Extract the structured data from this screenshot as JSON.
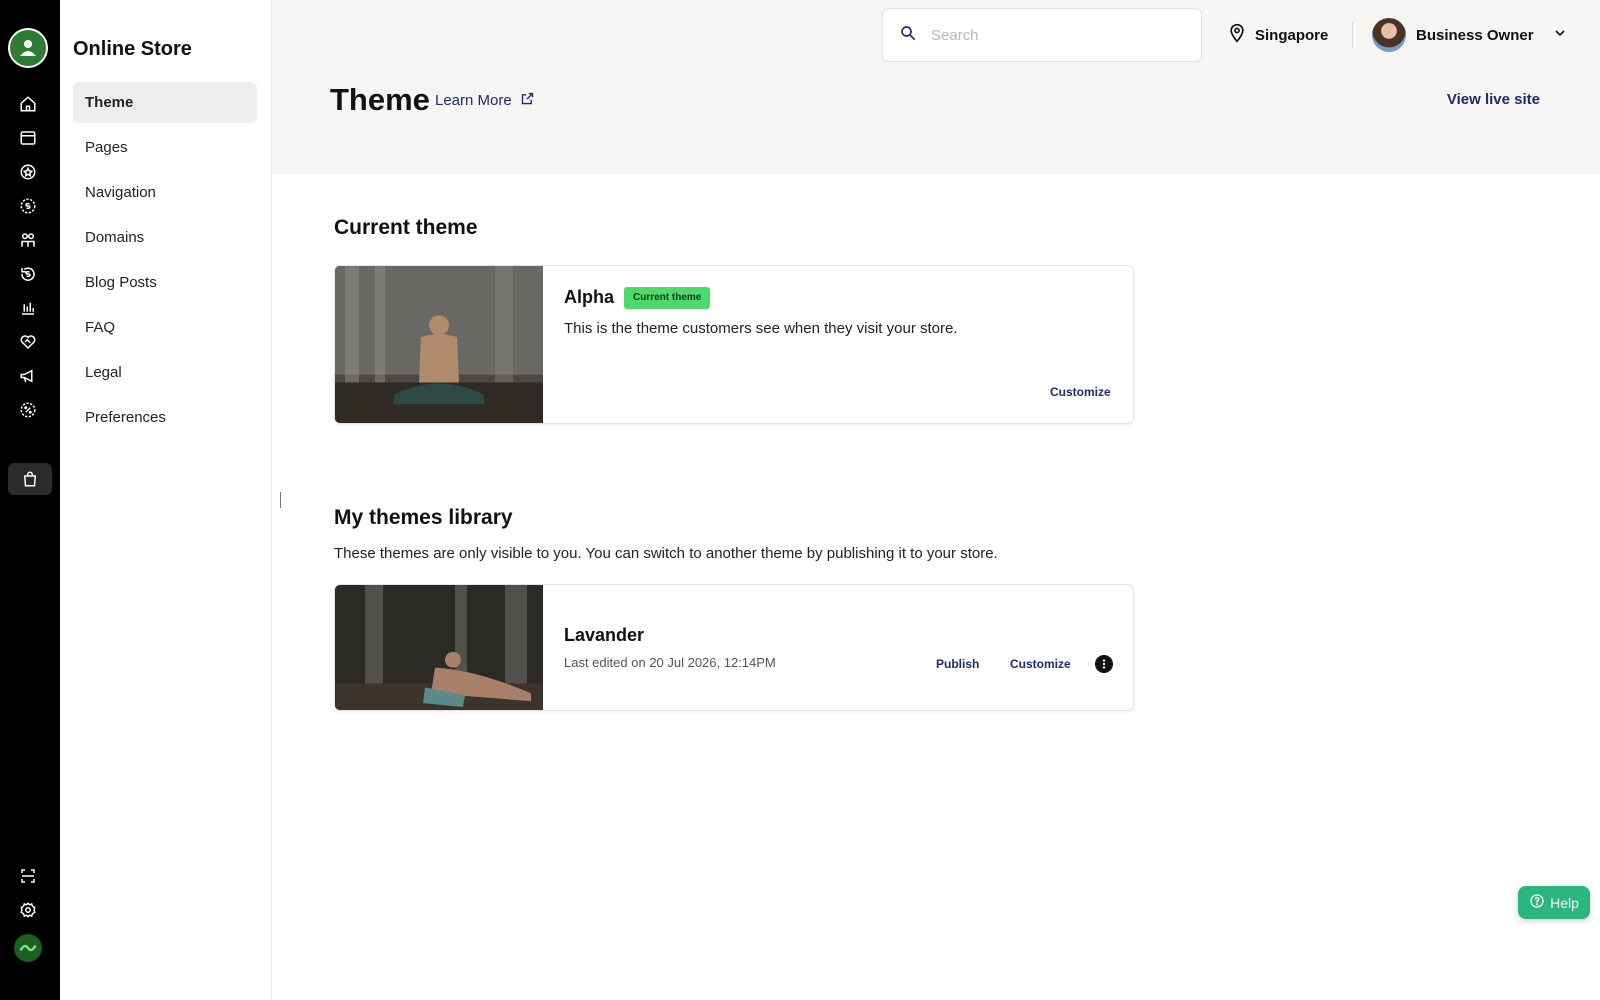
{
  "rail": {
    "icons": [
      "home-icon",
      "browser-icon",
      "star-badge-icon",
      "coin-icon",
      "people-icon",
      "refund-icon",
      "bar-chart-icon",
      "handshake-icon",
      "megaphone-icon",
      "discount-icon",
      "shopping-bag-icon",
      "scan-icon",
      "settings-icon",
      "brand-logo-icon"
    ]
  },
  "sidebar": {
    "title": "Online Store",
    "items": [
      {
        "label": "Theme"
      },
      {
        "label": "Pages"
      },
      {
        "label": "Navigation"
      },
      {
        "label": "Domains"
      },
      {
        "label": "Blog Posts"
      },
      {
        "label": "FAQ"
      },
      {
        "label": "Legal"
      },
      {
        "label": "Preferences"
      }
    ]
  },
  "header": {
    "search_placeholder": "Search",
    "location": "Singapore",
    "user_name": "Business Owner",
    "page_title": "Theme",
    "learn_more": "Learn More",
    "view_live_site": "View live site"
  },
  "current_theme": {
    "section_title": "Current theme",
    "name": "Alpha",
    "badge": "Current theme",
    "description": "This is the theme customers see when they visit your store.",
    "customize_label": "Customize"
  },
  "library": {
    "section_title": "My themes library",
    "description": "These themes are only visible to you. You can switch to another theme by publishing it to your store.",
    "themes": [
      {
        "name": "Lavander",
        "last_edited": "Last edited on 20 Jul 2026, 12:14PM",
        "publish_label": "Publish",
        "customize_label": "Customize"
      }
    ]
  },
  "help": {
    "label": "Help"
  },
  "colors": {
    "accent": "#1f2a6b",
    "badge_green": "#4dd96b",
    "help_green": "#2bb57f",
    "rail_bg": "#000000"
  }
}
